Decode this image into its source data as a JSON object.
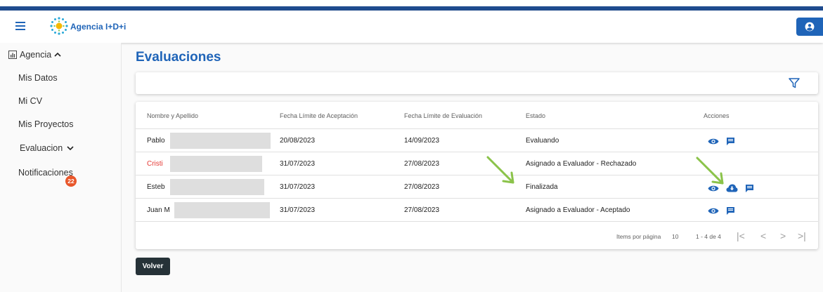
{
  "header": {
    "brand": "Agencia I+D+i",
    "menu_icon": "hamburger-icon",
    "user_icon": "account-icon",
    "colors": {
      "accent": "#1f4c8f",
      "brand": "#1f64b8"
    }
  },
  "sidebar": {
    "agencia": "Agencia",
    "mis_datos": "Mis Datos",
    "mi_cv": "Mi CV",
    "mis_proyectos": "Mis Proyectos",
    "evaluacion": "Evaluacion",
    "notificaciones": "Notificaciones",
    "notif_count": "22"
  },
  "main": {
    "title": "Evaluaciones",
    "filter_icon": "filter-icon",
    "columns": {
      "name": "Nombre y Apellido",
      "fecha_aceptacion": "Fecha Límite de Aceptación",
      "fecha_evaluacion": "Fecha Límite de Evaluación",
      "estado": "Estado",
      "acciones": "Acciones"
    },
    "rows": [
      {
        "name": "Pablo",
        "fecha_aceptacion": "20/08/2023",
        "fecha_evaluacion": "14/09/2023",
        "estado": "Evaluando",
        "name_color": "#212121"
      },
      {
        "name": "Cristi",
        "fecha_aceptacion": "31/07/2023",
        "fecha_evaluacion": "27/08/2023",
        "estado": "Asignado a Evaluador - Rechazado",
        "name_color": "#e53935"
      },
      {
        "name": "Esteb",
        "fecha_aceptacion": "31/07/2023",
        "fecha_evaluacion": "27/08/2023",
        "estado": "Finalizada",
        "name_color": "#212121"
      },
      {
        "name": "Juan M",
        "fecha_aceptacion": "31/07/2023",
        "fecha_evaluacion": "27/08/2023",
        "estado": "Asignado a Evaluador - Aceptado",
        "name_color": "#212121"
      }
    ],
    "paginator": {
      "items_label": "Items por página",
      "page_size": "10",
      "range": "1 - 4 de 4"
    },
    "back_label": "Volver"
  }
}
